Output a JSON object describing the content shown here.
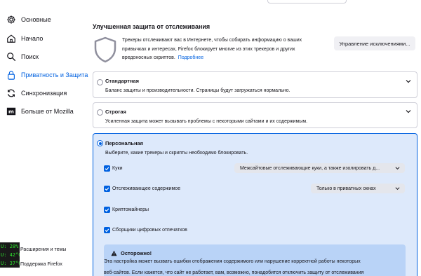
{
  "sidebar": {
    "items": [
      {
        "label": "Основные",
        "icon": "gear-icon"
      },
      {
        "label": "Начало",
        "icon": "home-icon"
      },
      {
        "label": "Поиск",
        "icon": "search-icon"
      },
      {
        "label": "Приватность и Защита",
        "icon": "lock-icon",
        "active": true
      },
      {
        "label": "Синхронизация",
        "icon": "sync-icon"
      },
      {
        "label": "Больше от Mozilla",
        "icon": "mozilla-icon"
      }
    ],
    "footer": {
      "extensions": "Расширения и темы",
      "support": "Поддержка Firefox"
    },
    "sysmon": [
      "U: 28%",
      "U: 42°C",
      "U: 37°C"
    ]
  },
  "tracking": {
    "title": "Улучшенная защита от отслеживания",
    "intro_lines": [
      "Трекеры отслеживают вас в Интернете, чтобы собирать информацию о ваших",
      "привычках и интересах, Firefox блокирует многие из этих трекеров и других",
      "вредоносных скриптов."
    ],
    "learn_more": "Подробнее",
    "manage_button": "Управление исключениями...",
    "standard": {
      "title": "Стандартная",
      "desc": "Баланс защиты и производительности. Страницы будут загружаться нормально."
    },
    "strict": {
      "title": "Строгая",
      "desc": "Усиленная защита может вызывать проблемы с некоторыми сайтами и их содержимым."
    },
    "custom": {
      "title": "Персональная",
      "desc": "Выберите, какие трекеры и скрипты необходимо блокировать.",
      "options": [
        {
          "label": "Куки",
          "checked": true,
          "select": "Межсайтовые отслеживающие куки, а также изолировать д..."
        },
        {
          "label": "Отслеживающее содержимое",
          "checked": true,
          "select": "Только в приватных окнах"
        },
        {
          "label": "Криптомайнеры",
          "checked": true
        },
        {
          "label": "Сборщики цифровых отпечатков",
          "checked": true
        }
      ],
      "warning": {
        "title": "Осторожно!",
        "lines": [
          "Эта настройка может вызвать ошибки отображения содержимого или нарушение корректной работы некоторых",
          "веб-сайтов. Если кажется, что сайт не работает, вам, возможно, понадобится отключить защиту от отслеживания"
        ]
      }
    }
  },
  "colors": {
    "accent": "#0061e0",
    "custom_bg": "#dde9fb",
    "warning_bg": "#b9d3f7"
  }
}
